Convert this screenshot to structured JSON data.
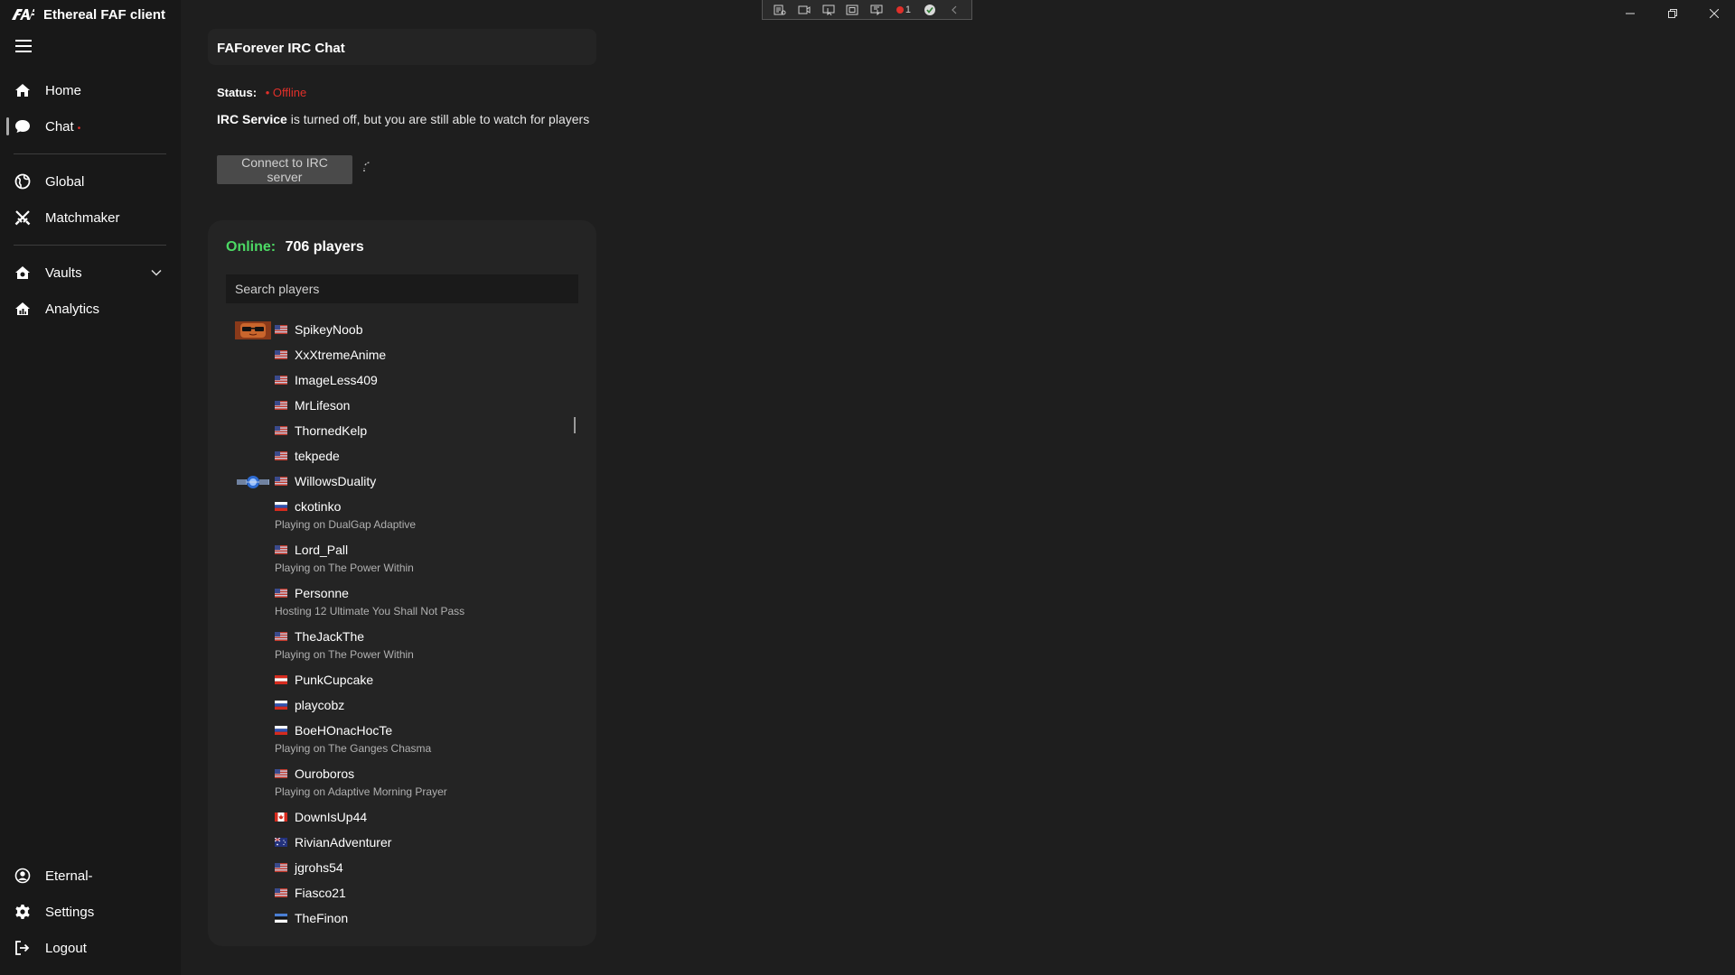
{
  "app": {
    "title": "Ethereal FAF client"
  },
  "nav": {
    "home": "Home",
    "chat": "Chat",
    "chat_dot": "•",
    "global": "Global",
    "matchmaker": "Matchmaker",
    "vaults": "Vaults",
    "analytics": "Analytics",
    "user": "Eternal-",
    "settings": "Settings",
    "logout": "Logout"
  },
  "chat_header": {
    "title": "FAForever IRC Chat"
  },
  "status": {
    "label": "Status:",
    "value": "• Offline"
  },
  "irc": {
    "service": "IRC Service",
    "note": " is turned off, but you are still able to watch for players"
  },
  "connect_button": "Connect to IRC server",
  "online": {
    "label": "Online:",
    "count": "706 players"
  },
  "search": {
    "placeholder": "Search players"
  },
  "overlay_toolbar": {
    "counter": "1"
  },
  "colors": {
    "accent_green": "#4cd964",
    "status_red": "#e0302a",
    "background": "#1e1e1e",
    "card": "#242424"
  },
  "players": [
    {
      "name": "SpikeyNoob",
      "flag": "us",
      "game": "",
      "avatar": "sunglasses-avatar"
    },
    {
      "name": "XxXtremeAnime",
      "flag": "us",
      "game": ""
    },
    {
      "name": "ImageLess409",
      "flag": "us",
      "game": ""
    },
    {
      "name": "MrLifeson",
      "flag": "us",
      "game": ""
    },
    {
      "name": "ThornedKelp",
      "flag": "us",
      "game": ""
    },
    {
      "name": "tekpede",
      "flag": "us",
      "game": ""
    },
    {
      "name": "WillowsDuality",
      "flag": "us",
      "game": "",
      "avatar": "satellite-avatar"
    },
    {
      "name": "ckotinko",
      "flag": "ru",
      "game": "Playing on DualGap Adaptive"
    },
    {
      "name": "Lord_Pall",
      "flag": "us",
      "game": "Playing on The Power Within"
    },
    {
      "name": "Personne",
      "flag": "us",
      "game": "Hosting 12 Ultimate You Shall Not Pass"
    },
    {
      "name": "TheJackThe",
      "flag": "us",
      "game": "Playing on The Power Within"
    },
    {
      "name": "PunkCupcake",
      "flag": "at",
      "game": ""
    },
    {
      "name": "playcobz",
      "flag": "ru",
      "game": ""
    },
    {
      "name": "BoeHOnacHocTe",
      "flag": "ru",
      "game": "Playing on The Ganges Chasma"
    },
    {
      "name": "Ouroboros",
      "flag": "us",
      "game": "Playing on Adaptive Morning Prayer"
    },
    {
      "name": "DownIsUp44",
      "flag": "ca",
      "game": ""
    },
    {
      "name": "RivianAdventurer",
      "flag": "au",
      "game": ""
    },
    {
      "name": "jgrohs54",
      "flag": "us",
      "game": ""
    },
    {
      "name": "Fiasco21",
      "flag": "us",
      "game": ""
    },
    {
      "name": "TheFinon",
      "flag": "ee",
      "game": ""
    }
  ]
}
